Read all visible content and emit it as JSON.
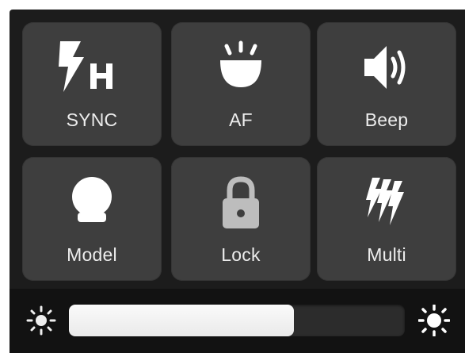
{
  "controls": {
    "items": [
      {
        "label": "SYNC",
        "icon": "flash-high-speed-sync-icon"
      },
      {
        "label": "AF",
        "icon": "af-assist-lamp-icon"
      },
      {
        "label": "Beep",
        "icon": "speaker-icon"
      },
      {
        "label": "Model",
        "icon": "modeling-light-bulb-icon"
      },
      {
        "label": "Lock",
        "icon": "padlock-icon"
      },
      {
        "label": "Multi",
        "icon": "multi-flash-icon"
      }
    ]
  },
  "brightness": {
    "level": 0.67,
    "min_icon": "sun-dim-icon",
    "max_icon": "sun-bright-icon"
  },
  "colors": {
    "panel_bg": "#1c1c1c",
    "tile_bg": "#3e3e3e",
    "icon_color": "#ffffff",
    "label_color": "#ededed",
    "slider_fill": "#f2f2f2"
  }
}
